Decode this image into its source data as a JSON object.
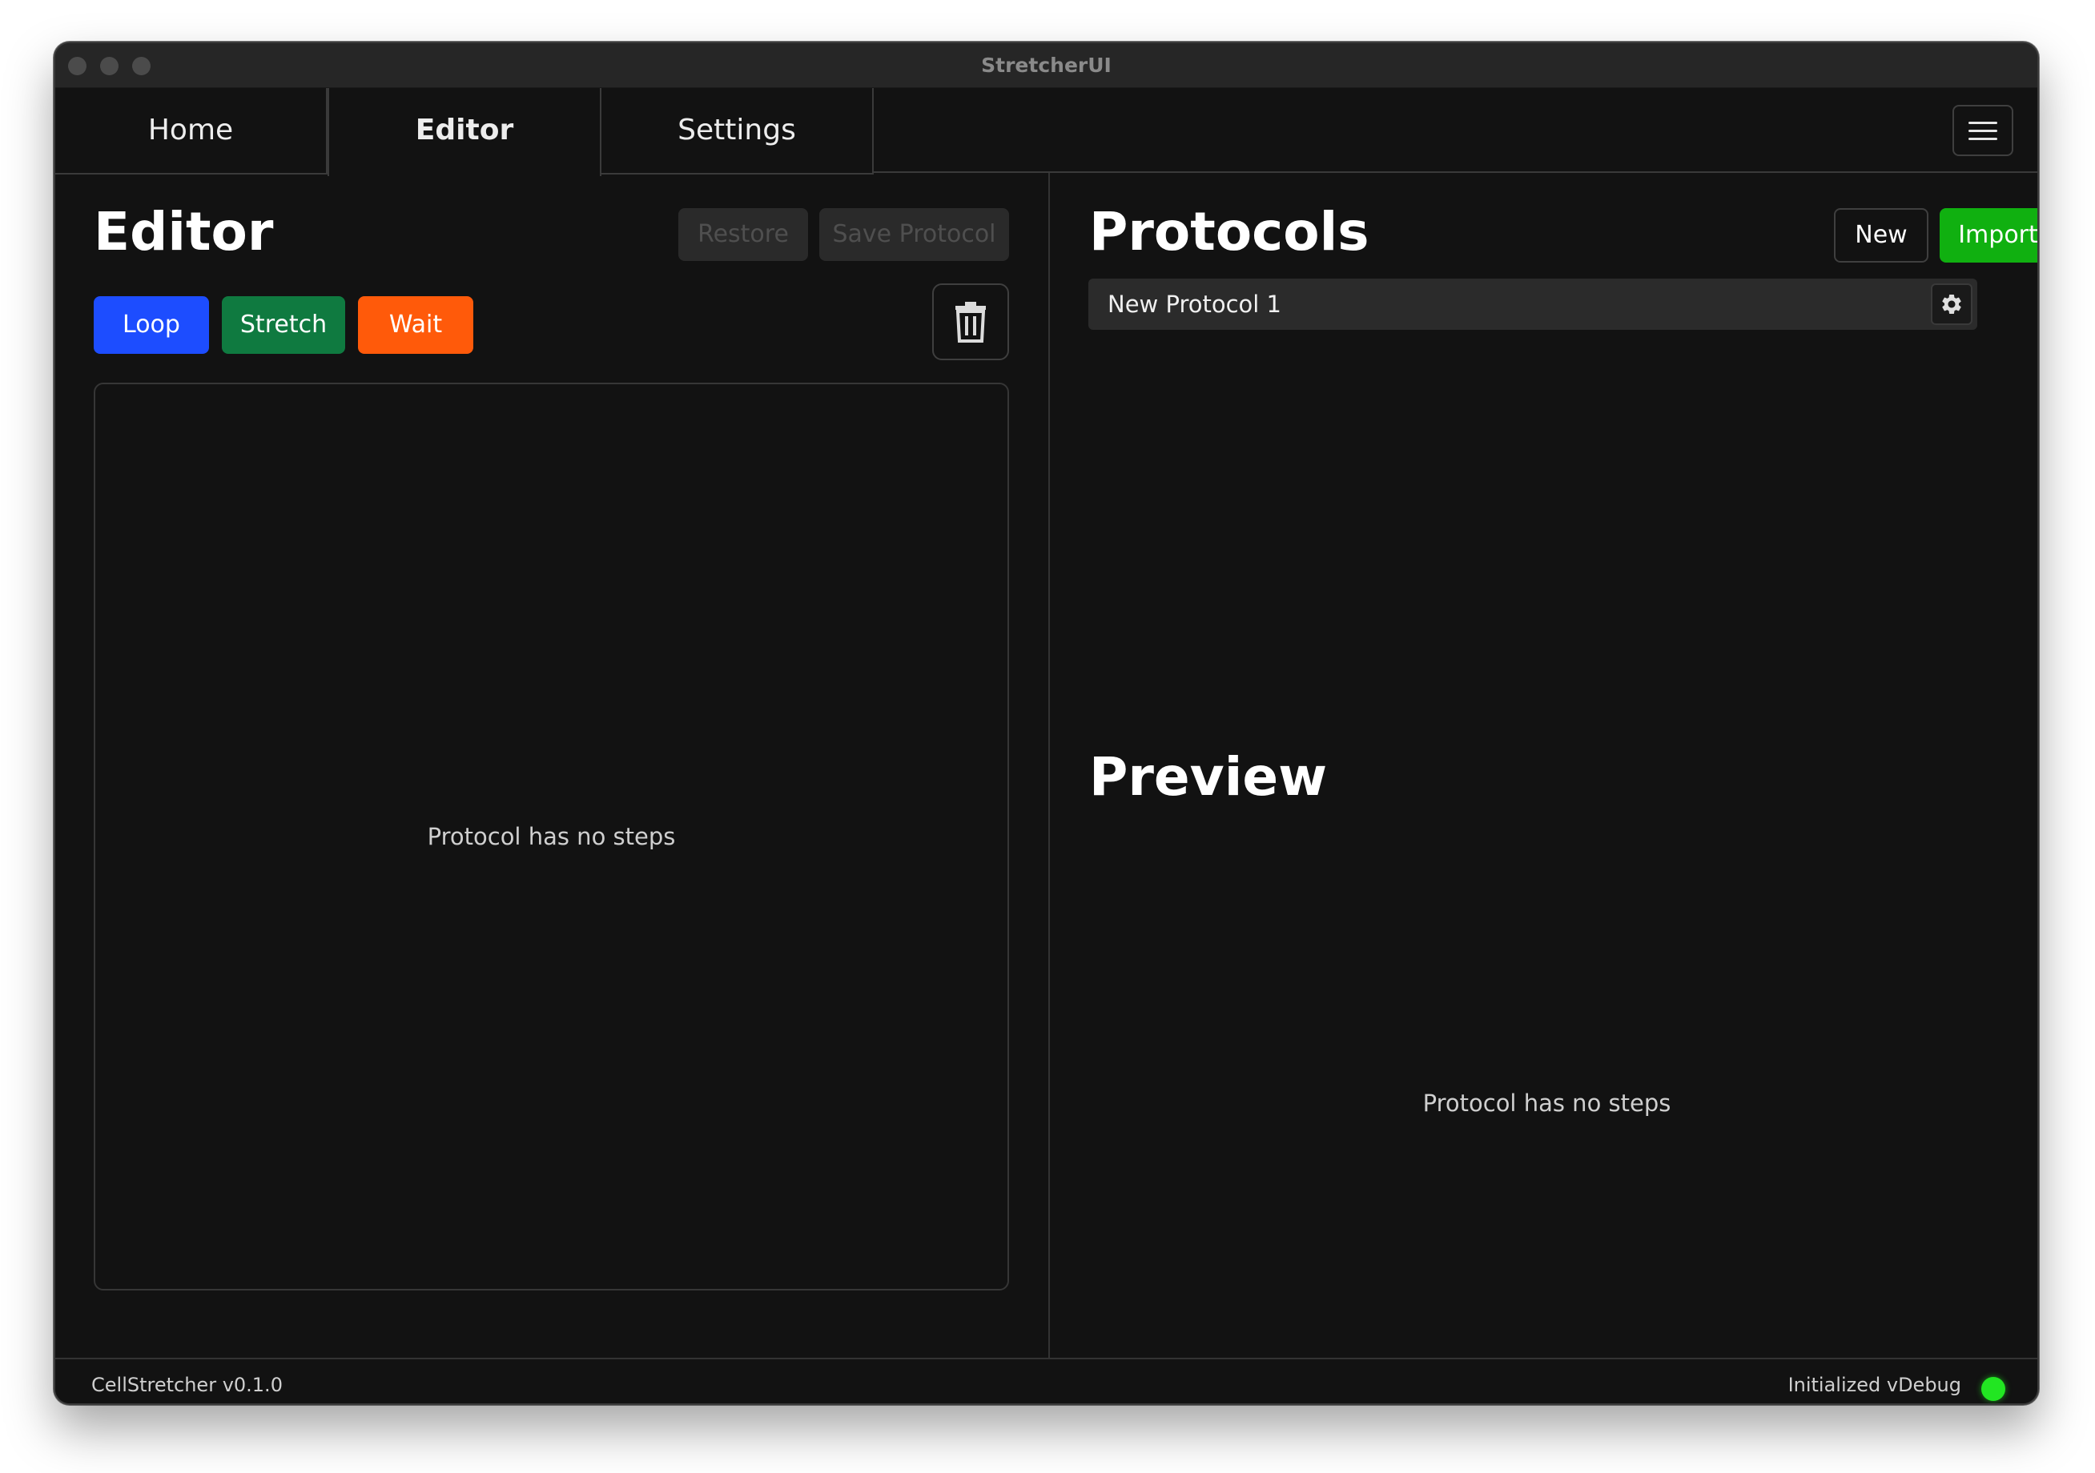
{
  "window": {
    "title": "StretcherUI"
  },
  "tabs": [
    {
      "label": "Home"
    },
    {
      "label": "Editor"
    },
    {
      "label": "Settings"
    }
  ],
  "menu": {
    "icon": "hamburger-menu-icon"
  },
  "editor": {
    "title": "Editor",
    "restore_label": "Restore",
    "save_label": "Save Protocol",
    "step_buttons": {
      "loop": "Loop",
      "stretch": "Stretch",
      "wait": "Wait"
    },
    "trash_icon": "trash-icon",
    "empty_message": "Protocol has no steps"
  },
  "protocols": {
    "title": "Protocols",
    "new_label": "New",
    "import_label": "Import",
    "items": [
      {
        "name": "New Protocol 1"
      }
    ],
    "settings_icon": "gear-icon"
  },
  "preview": {
    "title": "Preview",
    "empty_message": "Protocol has no steps"
  },
  "footer": {
    "version": "CellStretcher v0.1.0",
    "status": "Initialized vDebug"
  },
  "colors": {
    "loop": "#1d4dff",
    "stretch": "#0f7a40",
    "wait": "#ff5a0a",
    "import": "#10b010",
    "status_ok": "#22e622"
  }
}
